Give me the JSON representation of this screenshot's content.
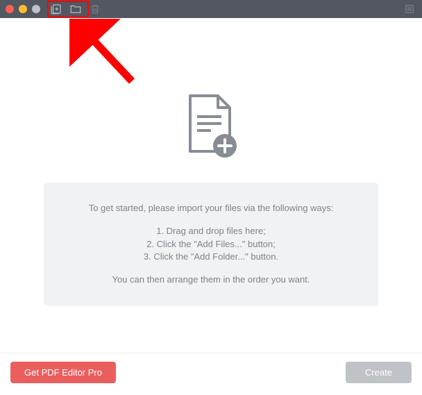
{
  "instructions": {
    "intro": "To get started, please import your files via the following ways:",
    "line1": "1. Drag and drop files here;",
    "line2": "2. Click the \"Add Files...\" button;",
    "line3": "3. Click the \"Add Folder...\" button.",
    "outro": "You can then arrange them in the order you want."
  },
  "footer": {
    "pro_button": "Get PDF Editor Pro",
    "create_button": "Create"
  }
}
